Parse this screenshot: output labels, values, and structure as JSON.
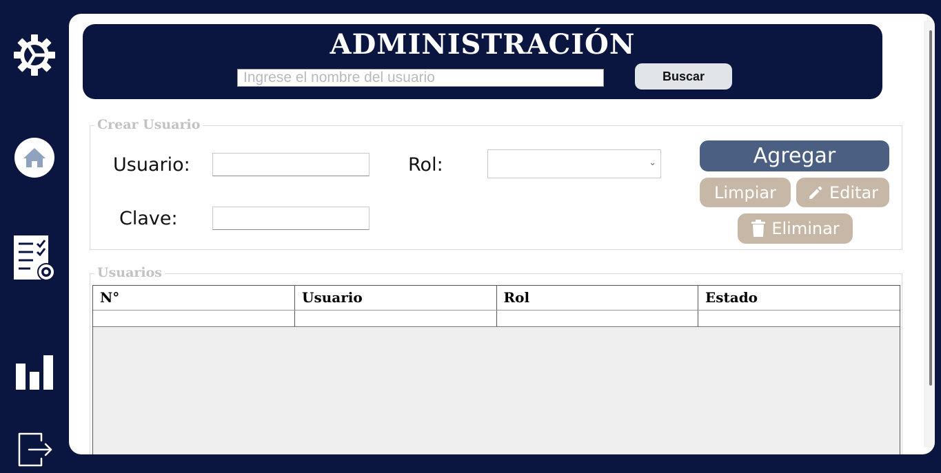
{
  "sidebar": {
    "items": [
      {
        "icon": "gear-icon"
      },
      {
        "icon": "home-icon"
      },
      {
        "icon": "checklist-settings-icon"
      },
      {
        "icon": "bar-chart-icon"
      },
      {
        "icon": "logout-icon"
      }
    ]
  },
  "header": {
    "title": "ADMINISTRACIÓN",
    "search_placeholder": "Ingrese el nombre del usuario",
    "search_value": "",
    "search_button": "Buscar"
  },
  "crear_usuario": {
    "legend": "Crear Usuario",
    "usuario_label": "Usuario:",
    "usuario_value": "",
    "clave_label": "Clave:",
    "clave_value": "",
    "rol_label": "Rol:",
    "rol_selected": "",
    "buttons": {
      "agregar": "Agregar",
      "limpiar": "Limpiar",
      "editar": "Editar",
      "eliminar": "Eliminar"
    }
  },
  "usuarios": {
    "legend": "Usuarios",
    "columns": [
      "N°",
      "Usuario",
      "Rol",
      "Estado"
    ],
    "rows": [
      [
        "",
        "",
        "",
        ""
      ]
    ]
  },
  "colors": {
    "navy": "#0b1640",
    "agregar": "#4a5f82",
    "secondary_button": "#c6b7a6",
    "legend_text": "#c2c2c2"
  }
}
